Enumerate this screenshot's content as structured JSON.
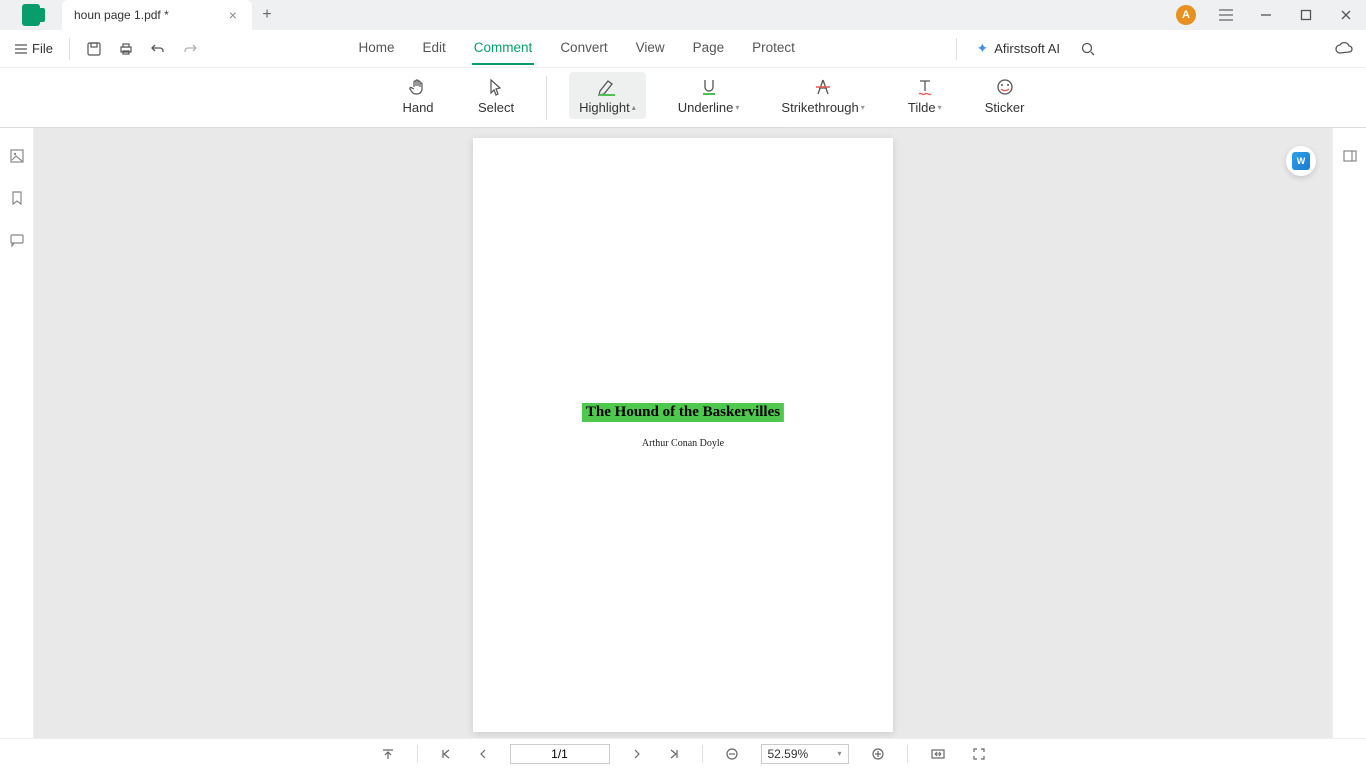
{
  "titlebar": {
    "tab_title": "houn page 1.pdf *",
    "avatar_letter": "A"
  },
  "menubar": {
    "file_label": "File",
    "items": [
      "Home",
      "Edit",
      "Comment",
      "Convert",
      "View",
      "Page",
      "Protect"
    ],
    "active_index": 2,
    "ai_label": "Afirstsoft AI"
  },
  "comment_tools": {
    "hand": "Hand",
    "select": "Select",
    "highlight": "Highlight",
    "underline": "Underline",
    "strikethrough": "Strikethrough",
    "tilde": "Tilde",
    "sticker": "Sticker"
  },
  "color_picker": {
    "colors": [
      "#b0b0b0",
      "#e86060",
      "#e89030",
      "#f0e040",
      "#50c050",
      "#7090f0",
      "#b080f0"
    ]
  },
  "document": {
    "title": "The Hound of the Baskervilles",
    "author": "Arthur Conan Doyle"
  },
  "statusbar": {
    "page": "1/1",
    "zoom": "52.59%"
  }
}
